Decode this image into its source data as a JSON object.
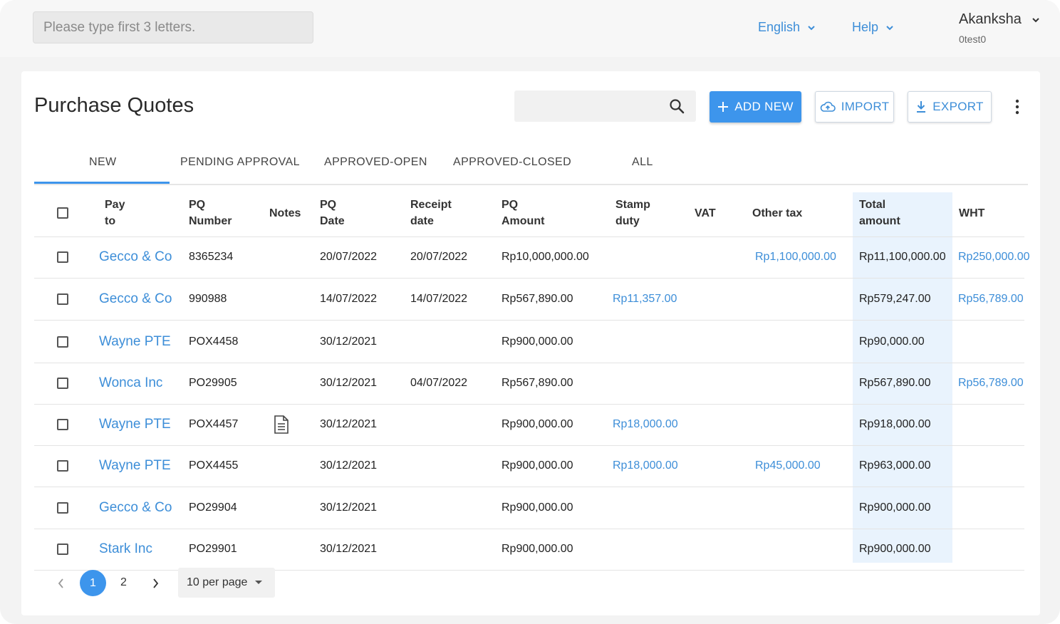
{
  "header": {
    "search_placeholder": "Please type first 3 letters.",
    "language": "English",
    "help": "Help",
    "user_name": "Akanksha",
    "user_sub": "0test0"
  },
  "page": {
    "title": "Purchase Quotes",
    "add_new": "ADD NEW",
    "import": "IMPORT",
    "export": "EXPORT"
  },
  "tabs": [
    "NEW",
    "PENDING APPROVAL",
    "APPROVED-OPEN",
    "APPROVED-CLOSED",
    "ALL"
  ],
  "active_tab": "NEW",
  "table": {
    "headers": {
      "pay_to": [
        "Pay",
        "to"
      ],
      "pq_number": [
        "PQ",
        "Number"
      ],
      "notes": [
        "Notes"
      ],
      "pq_date": [
        "PQ",
        "Date"
      ],
      "receipt_date": [
        "Receipt",
        "date"
      ],
      "pq_amount": [
        "PQ",
        "Amount"
      ],
      "stamp_duty": [
        "Stamp",
        "duty"
      ],
      "vat": [
        "VAT"
      ],
      "other_tax": [
        "Other tax"
      ],
      "total_amount": [
        "Total",
        "amount"
      ],
      "wht": [
        "WHT"
      ]
    },
    "rows": [
      {
        "pay_to": "Gecco & Co",
        "pq_number": "8365234",
        "notes": false,
        "pq_date": "20/07/2022",
        "receipt_date": "20/07/2022",
        "pq_amount": "Rp10,000,000.00",
        "stamp_duty": "",
        "vat": "",
        "other_tax": "Rp1,100,000.00",
        "total_amount": "Rp11,100,000.00",
        "wht": "Rp250,000.00"
      },
      {
        "pay_to": "Gecco & Co",
        "pq_number": "990988",
        "notes": false,
        "pq_date": "14/07/2022",
        "receipt_date": "14/07/2022",
        "pq_amount": "Rp567,890.00",
        "stamp_duty": "Rp11,357.00",
        "vat": "",
        "other_tax": "",
        "total_amount": "Rp579,247.00",
        "wht": "Rp56,789.00"
      },
      {
        "pay_to": "Wayne PTE",
        "pq_number": "POX4458",
        "notes": false,
        "pq_date": "30/12/2021",
        "receipt_date": "",
        "pq_amount": "Rp900,000.00",
        "stamp_duty": "",
        "vat": "",
        "other_tax": "",
        "total_amount": "Rp90,000.00",
        "wht": ""
      },
      {
        "pay_to": "Wonca Inc",
        "pq_number": "PO29905",
        "notes": false,
        "pq_date": "30/12/2021",
        "receipt_date": "04/07/2022",
        "pq_amount": "Rp567,890.00",
        "stamp_duty": "",
        "vat": "",
        "other_tax": "",
        "total_amount": "Rp567,890.00",
        "wht": "Rp56,789.00"
      },
      {
        "pay_to": "Wayne PTE",
        "pq_number": "POX4457",
        "notes": true,
        "pq_date": "30/12/2021",
        "receipt_date": "",
        "pq_amount": "Rp900,000.00",
        "stamp_duty": "Rp18,000.00",
        "vat": "",
        "other_tax": "",
        "total_amount": "Rp918,000.00",
        "wht": ""
      },
      {
        "pay_to": "Wayne PTE",
        "pq_number": "POX4455",
        "notes": false,
        "pq_date": "30/12/2021",
        "receipt_date": "",
        "pq_amount": "Rp900,000.00",
        "stamp_duty": "Rp18,000.00",
        "vat": "",
        "other_tax": "Rp45,000.00",
        "total_amount": "Rp963,000.00",
        "wht": ""
      },
      {
        "pay_to": "Gecco & Co",
        "pq_number": "PO29904",
        "notes": false,
        "pq_date": "30/12/2021",
        "receipt_date": "",
        "pq_amount": "Rp900,000.00",
        "stamp_duty": "",
        "vat": "",
        "other_tax": "",
        "total_amount": "Rp900,000.00",
        "wht": ""
      },
      {
        "pay_to": "Stark Inc",
        "pq_number": "PO29901",
        "notes": false,
        "pq_date": "30/12/2021",
        "receipt_date": "",
        "pq_amount": "Rp900,000.00",
        "stamp_duty": "",
        "vat": "",
        "other_tax": "",
        "total_amount": "Rp900,000.00",
        "wht": ""
      }
    ]
  },
  "pagination": {
    "current_page": "1",
    "next_page": "2",
    "per_page": "10 per page"
  },
  "colors": {
    "accent": "#3d95ec",
    "link": "#3d8ed8",
    "total_column_bg": "#e9f3fd"
  }
}
